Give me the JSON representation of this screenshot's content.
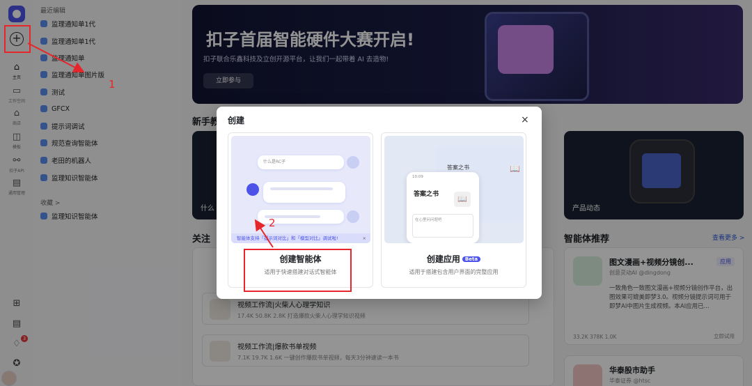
{
  "rail": {
    "nav": [
      {
        "label": "主页",
        "icon": "home-icon"
      },
      {
        "label": "工作空间",
        "icon": "workspace-icon"
      },
      {
        "label": "商店",
        "icon": "store-icon"
      },
      {
        "label": "模板",
        "icon": "template-icon"
      },
      {
        "label": "扣子API",
        "icon": "api-icon"
      },
      {
        "label": "通用管理",
        "icon": "manage-icon"
      }
    ],
    "notification_count": "3"
  },
  "sidebar": {
    "recent_title": "最近编辑",
    "recent": [
      "监理通知单1代",
      "监理通知单1代",
      "监理通知单",
      "监理通知单图片版",
      "测试",
      "GFCX",
      "提示词调试",
      "规范查询智能体",
      "老田的机器人",
      "监理知识智能体"
    ],
    "favorites_title": "收藏 >",
    "favorites": [
      "监理知识智能体"
    ]
  },
  "hero": {
    "title": "扣子首届智能硬件大赛开启!",
    "subtitle": "扣子联合乐鑫科技及立创开源平台，让我们一起带着 AI 去造物!",
    "button": "立即参与"
  },
  "sections": {
    "newbie": "新手教",
    "newbie_card_left": "什么",
    "newbie_card_right": "产品动态",
    "follow": "关注",
    "recommend": "智能体推荐",
    "view_more": "查看更多 >"
  },
  "recommend_cards": [
    {
      "title": "图文漫画+视频分镜创...",
      "author": "创意灵动AI @dingdong",
      "tag": "应用",
      "desc": "一致角色一致图文漫画+视频分镜创作平台，出图效果可媲美即梦3.0。视频分镜提示词可用于即梦AI中图片生成视频。本AI应用已...",
      "stats": "33.2K   378K   1.0K",
      "try": "立即试用"
    },
    {
      "title": "华泰股市助手",
      "author": "华泰证券 @htsc"
    }
  ],
  "follow_items": [
    {
      "title": "视频工作流|火柴人心理学知识",
      "stats": "17.4K  50.8K  2.8K  打造爆款火柴人心理学知识视频"
    },
    {
      "title": "视频工作流|爆款书单视频",
      "stats": "7.1K  19.7K  1.6K  一键创作爆款书单视频，每天3分钟速读一本书"
    }
  ],
  "modal": {
    "title": "创建",
    "close": "×",
    "agent": {
      "name": "创建智能体",
      "desc": "适用于快速搭建对话式智能体",
      "question": "什么是RC子",
      "tip": "智能体支持「提示词对比」和「模型对比」调试啦!",
      "tip_close": "×"
    },
    "app": {
      "name": "创建应用",
      "badge": "Beta",
      "desc": "适用于搭建包含用户界面的完整应用",
      "window_title": "答案之书",
      "phone_time": "10:09",
      "phone_title": "答案之书",
      "phone_input": "在心里问问题吧"
    }
  },
  "annotations": {
    "step1": "1",
    "step2": "2"
  },
  "colors": {
    "accent": "#4d53e8",
    "annotation": "#e6262b",
    "hero_bg": "#1c1f4a"
  }
}
